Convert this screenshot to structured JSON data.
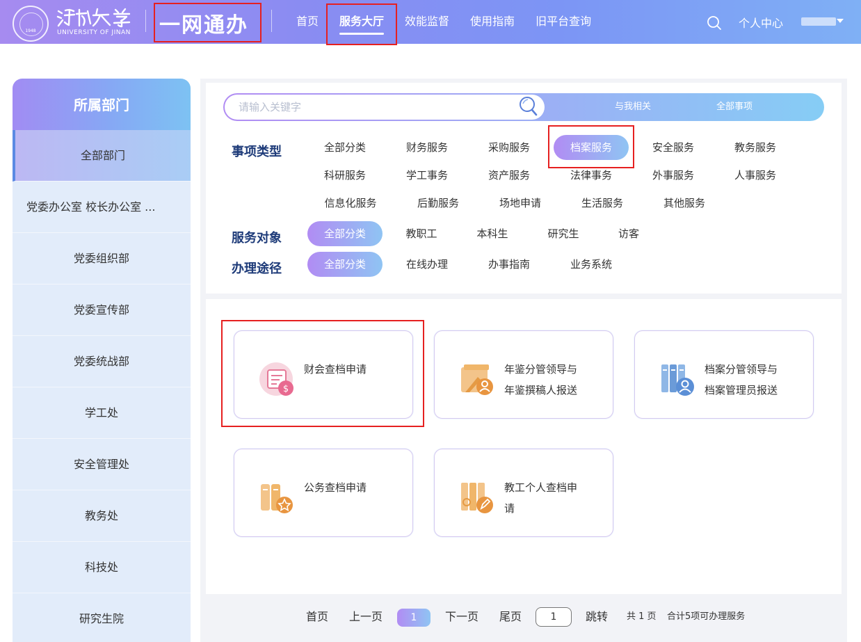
{
  "header": {
    "logo_en": "UNIVERSITY OF JINAN",
    "logo_seal_num": "1948",
    "brand": "一网通办",
    "nav": [
      {
        "label": "首页",
        "active": false
      },
      {
        "label": "服务大厅",
        "active": true
      },
      {
        "label": "效能监督",
        "active": false
      },
      {
        "label": "使用指南",
        "active": false
      },
      {
        "label": "旧平台查询",
        "active": false
      }
    ],
    "user_center": "个人中心"
  },
  "sidebar": {
    "title": "所属部门",
    "items": [
      {
        "label": "全部部门",
        "active": true
      },
      {
        "label": "党委办公室 校长办公室 ...",
        "active": false
      },
      {
        "label": "党委组织部",
        "active": false
      },
      {
        "label": "党委宣传部",
        "active": false
      },
      {
        "label": "党委统战部",
        "active": false
      },
      {
        "label": "学工处",
        "active": false
      },
      {
        "label": "安全管理处",
        "active": false
      },
      {
        "label": "教务处",
        "active": false
      },
      {
        "label": "科技处",
        "active": false
      },
      {
        "label": "研究生院",
        "active": false
      }
    ]
  },
  "search": {
    "placeholder": "请输入关键字",
    "value": "",
    "scope_related": "与我相关",
    "scope_all": "全部事项"
  },
  "filters": {
    "type_label": "事项类型",
    "types": [
      {
        "label": "全部分类",
        "active": false
      },
      {
        "label": "财务服务",
        "active": false
      },
      {
        "label": "采购服务",
        "active": false
      },
      {
        "label": "档案服务",
        "active": true
      },
      {
        "label": "安全服务",
        "active": false
      },
      {
        "label": "教务服务",
        "active": false
      },
      {
        "label": "科研服务",
        "active": false
      },
      {
        "label": "学工事务",
        "active": false
      },
      {
        "label": "资产服务",
        "active": false
      },
      {
        "label": "法律事务",
        "active": false
      },
      {
        "label": "外事服务",
        "active": false
      },
      {
        "label": "人事服务",
        "active": false
      },
      {
        "label": "信息化服务",
        "active": false
      },
      {
        "label": "后勤服务",
        "active": false
      },
      {
        "label": "场地申请",
        "active": false
      },
      {
        "label": "生活服务",
        "active": false
      },
      {
        "label": "其他服务",
        "active": false
      }
    ],
    "target_label": "服务对象",
    "targets": [
      {
        "label": "全部分类",
        "active": true
      },
      {
        "label": "教职工",
        "active": false
      },
      {
        "label": "本科生",
        "active": false
      },
      {
        "label": "研究生",
        "active": false
      },
      {
        "label": "访客",
        "active": false
      }
    ],
    "channel_label": "办理途径",
    "channels": [
      {
        "label": "全部分类",
        "active": true
      },
      {
        "label": "在线办理",
        "active": false
      },
      {
        "label": "办事指南",
        "active": false
      },
      {
        "label": "业务系统",
        "active": false
      }
    ]
  },
  "services": [
    {
      "title": "财会查档申请",
      "icon": "finance-archive-icon"
    },
    {
      "title_line1": "年鉴分管领导与",
      "title_line2": "年鉴撰稿人报送",
      "icon": "yearbook-icon"
    },
    {
      "title_line1": "档案分管领导与",
      "title_line2": "档案管理员报送",
      "icon": "archive-manager-icon"
    },
    {
      "title": "公务查档申请",
      "icon": "official-archive-icon"
    },
    {
      "title_line1": "教工个人查档申",
      "title_line2": "请",
      "icon": "staff-archive-icon"
    }
  ],
  "pagination": {
    "first": "首页",
    "prev": "上一页",
    "current": "1",
    "next": "下一页",
    "last": "尾页",
    "jump_value": "1",
    "jump": "跳转",
    "total_pages": "共 1 页",
    "total_items": "合计5项可办理服务"
  },
  "colors": {
    "accent_gradient_start": "#b18cf3",
    "accent_gradient_end": "#86cdf5",
    "label_navy": "#1e3b79",
    "annotation_red": "#e62020"
  }
}
